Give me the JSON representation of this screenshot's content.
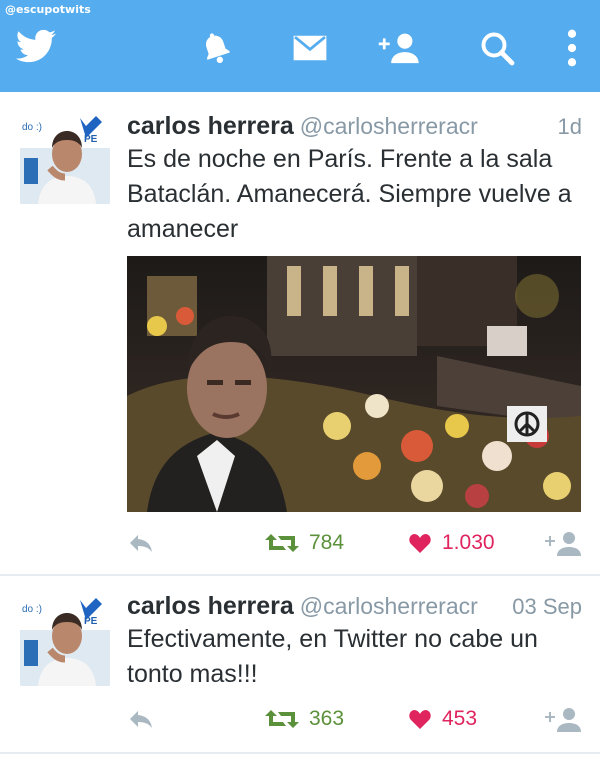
{
  "watermark": "@escupotwits",
  "colors": {
    "topbar": "#55acee",
    "retweet": "#5c913b",
    "favorite": "#e0245e",
    "muted": "#8899a6"
  },
  "nav": {
    "icons": [
      "twitter-bird-icon",
      "notifications-bell-icon",
      "messages-envelope-icon",
      "add-user-icon",
      "search-icon",
      "more-options-icon"
    ]
  },
  "tweets": [
    {
      "name": "carlos herrera",
      "handle": "@carlosherreracr",
      "time": "1d",
      "text": "Es de noche en París. Frente a la sala Bataclán. Amanecerá. Siempre vuelve a amanecer",
      "avatar_caption": "do :)",
      "avatar_logo": "PE",
      "retweets": "784",
      "favorites": "1.030"
    },
    {
      "name": "carlos herrera",
      "handle": "@carlosherreracr",
      "time": "03 Sep",
      "text": "Efectivamente, en Twitter no cabe un tonto mas!!!",
      "avatar_caption": "do :)",
      "avatar_logo": "PE",
      "retweets": "363",
      "favorites": "453"
    }
  ]
}
